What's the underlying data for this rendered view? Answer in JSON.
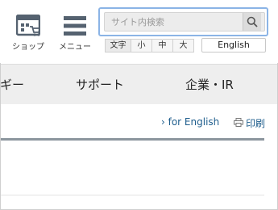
{
  "header": {
    "shop_label": "ショップ",
    "menu_label": "メニュー",
    "search": {
      "placeholder": "サイト内検索",
      "value": ""
    },
    "font_size": {
      "label": "文字",
      "options": [
        "小",
        "中",
        "大"
      ]
    },
    "language_label": "English"
  },
  "nav": {
    "items": [
      "ギー",
      "サポート",
      "企業・IR"
    ]
  },
  "utility": {
    "for_english": "› for English",
    "print": "印刷"
  },
  "colors": {
    "search_focus_border": "#8bb4e6",
    "nav_background": "#eeeeee",
    "link": "#1f5e8d",
    "rule": "#8c969e"
  }
}
